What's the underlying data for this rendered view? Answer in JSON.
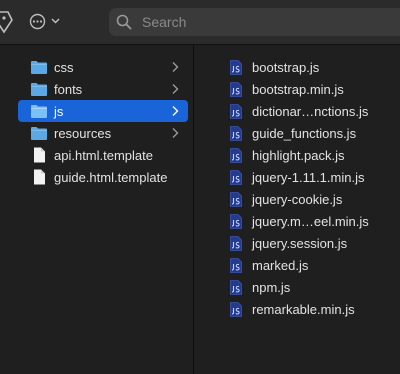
{
  "toolbar": {
    "search_placeholder": "Search"
  },
  "left_column": {
    "items": [
      {
        "label": "css",
        "kind": "folder",
        "has_children": true
      },
      {
        "label": "fonts",
        "kind": "folder",
        "has_children": true
      },
      {
        "label": "js",
        "kind": "folder",
        "has_children": true,
        "selected": true
      },
      {
        "label": "resources",
        "kind": "folder",
        "has_children": true
      },
      {
        "label": "api.html.template",
        "kind": "file"
      },
      {
        "label": "guide.html.template",
        "kind": "file"
      }
    ]
  },
  "right_column": {
    "files": [
      "bootstrap.js",
      "bootstrap.min.js",
      "dictionar…nctions.js",
      "guide_functions.js",
      "highlight.pack.js",
      "jquery-1.11.1.min.js",
      "jquery-cookie.js",
      "jquery.m…eel.min.js",
      "jquery.session.js",
      "marked.js",
      "npm.js",
      "remarkable.min.js"
    ]
  },
  "colors": {
    "selection": "#1a64d9",
    "folder": "#5aa9e6",
    "js_icon": "#243a8c"
  }
}
